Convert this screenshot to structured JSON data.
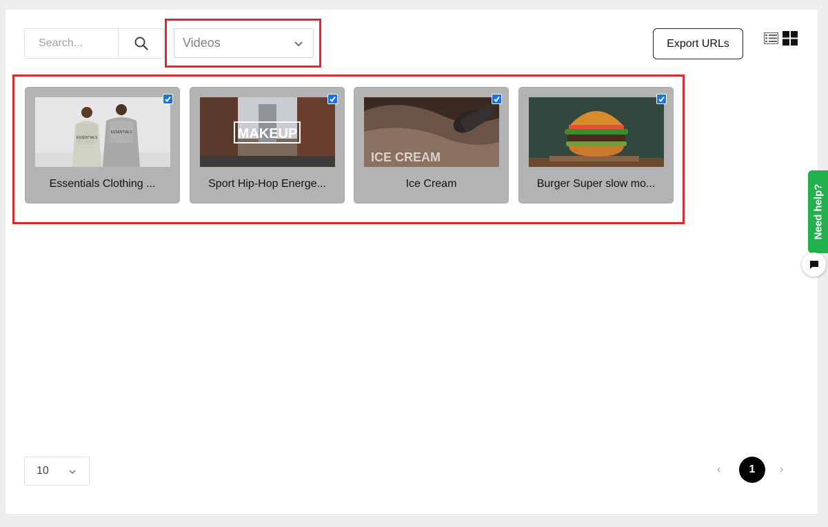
{
  "toolbar": {
    "search_placeholder": "Search...",
    "media_type_value": "Videos",
    "export_label": "Export URLs",
    "list_view_icon": "list-view-icon",
    "grid_view_icon": "grid-view-icon"
  },
  "items": [
    {
      "title": "Essentials Clothing ...",
      "checked": true,
      "thumb_icon": "essentials-hoodies-thumbnail"
    },
    {
      "title": "Sport Hip-Hop Energe...",
      "checked": true,
      "thumb_icon": "makeup-street-thumbnail",
      "thumb_text": "MAKEUP"
    },
    {
      "title": "Ice Cream",
      "checked": true,
      "thumb_icon": "ice-cream-thumbnail",
      "thumb_text": "ICE CREAM"
    },
    {
      "title": "Burger Super slow mo...",
      "checked": true,
      "thumb_icon": "burger-thumbnail"
    }
  ],
  "pagination": {
    "page_size": "10",
    "prev": "‹",
    "current": "1",
    "next": "›"
  },
  "help": {
    "label": "Need help?",
    "chat_icon": "chat-icon"
  },
  "colors": {
    "highlight": "#e0262d",
    "checkbox": "#1a73e8",
    "card_bg": "#b3b3b3",
    "help_green": "#22b14c"
  }
}
